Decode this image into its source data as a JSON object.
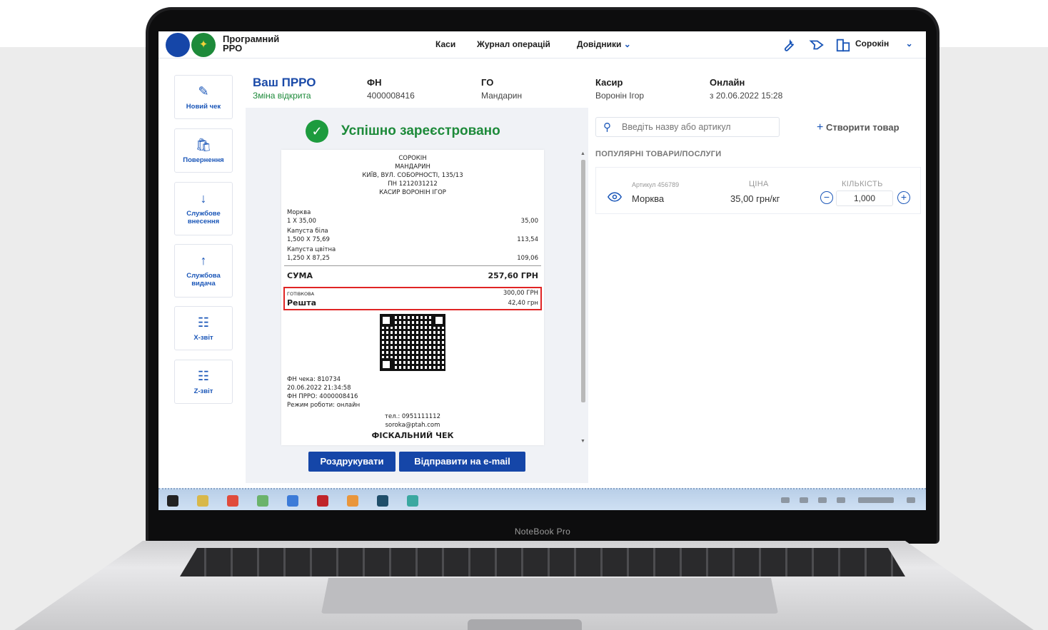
{
  "device": {
    "brand": "NoteBook Pro"
  },
  "header": {
    "app_name": "Програмний РРО",
    "nav": [
      "Каси",
      "Журнал операцій",
      "Довідники"
    ],
    "user": "Сорокін"
  },
  "toolbar": [
    {
      "label": "Новий чек"
    },
    {
      "label": "Повернення"
    },
    {
      "label": "Службове внесення"
    },
    {
      "label": "Службова видача"
    },
    {
      "label": "Х-звіт"
    },
    {
      "label": "Z-звіт"
    }
  ],
  "info": {
    "title": "Ваш ПРРО",
    "status": "Зміна відкрита",
    "fn_label": "ФН",
    "fn_value": "4000008416",
    "go_label": "ГО",
    "go_value": "Мандарин",
    "cashier_label": "Касир",
    "cashier_value": "Воронін Ігор",
    "online_label": "Онлайн",
    "online_value": "з 20.06.2022 15:28"
  },
  "success_message": "Успішно зареєстровано",
  "receipt": {
    "header_lines": [
      "СОРОКІН",
      "МАНДАРИН",
      "КИЇВ, ВУЛ. СОБОРНОСТІ, 135/13",
      "ПН 1212031212",
      "КАСИР ВОРОНІН ІГОР"
    ],
    "items": [
      {
        "name": "Морква",
        "qty": "1 X 35,00",
        "sum": "35,00"
      },
      {
        "name": "Капуста біла",
        "qty": "1,500 X 75,69",
        "sum": "113,54"
      },
      {
        "name": "Капуста цвітна",
        "qty": "1,250 X 87,25",
        "sum": "109,06"
      }
    ],
    "total_label": "СУМА",
    "total_value": "257,60 ГРН",
    "cash_label": "ГОТІВКОВА",
    "cash_value": "300,00 ГРН",
    "change_label": "Решта",
    "change_value": "42,40 грн",
    "footer_lines": [
      "ФН чека: 810734",
      "20.06.2022 21:34:58",
      "ФН ПРРО: 4000008416",
      "Режим роботи: онлайн"
    ],
    "phone": "тел.: 0951111112",
    "email": "soroka@ptah.com",
    "fiscal": "ФІСКАЛЬНИЙ ЧЕК"
  },
  "buttons": {
    "print": "Роздрукувати",
    "email": "Відправити на e-mail"
  },
  "right": {
    "search_placeholder": "Введіть назву або артикул",
    "create": "Створити товар",
    "popular_title": "ПОПУЛЯРНІ ТОВАРИ/ПОСЛУГИ",
    "product": {
      "sku": "Артикул 456789",
      "name": "Морква",
      "price_label": "ЦІНА",
      "price": "35,00 грн/кг",
      "qty_label": "КІЛЬКІСТЬ",
      "qty": "1,000"
    }
  },
  "colors": {
    "primary": "#1546a8",
    "success": "#1d8a3a",
    "highlight": "#e02424"
  }
}
